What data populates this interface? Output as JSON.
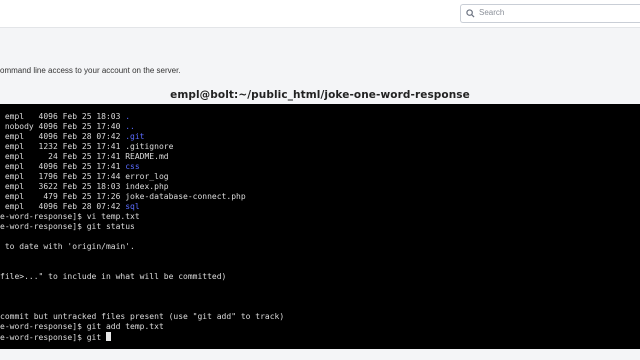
{
  "search": {
    "placeholder": "Search"
  },
  "description": "ommand line access to your account on the server.",
  "session_title": "empl@bolt:~/public_html/joke-one-word-response",
  "terminal": {
    "lines": [
      {
        "pre": " empl   4096 Feb 25 18:03 ",
        "hl": ".",
        "post": ""
      },
      {
        "pre": " nobody 4096 Feb 25 17:40 ",
        "hl": "..",
        "post": ""
      },
      {
        "pre": " empl   4096 Feb 28 07:42 ",
        "hl": ".git",
        "post": ""
      },
      {
        "pre": " empl   1232 Feb 25 17:41 .gitignore",
        "hl": "",
        "post": ""
      },
      {
        "pre": " empl     24 Feb 25 17:41 README.md",
        "hl": "",
        "post": ""
      },
      {
        "pre": " empl   4096 Feb 25 17:41 ",
        "hl": "css",
        "post": ""
      },
      {
        "pre": " empl   1796 Feb 25 17:44 error_log",
        "hl": "",
        "post": ""
      },
      {
        "pre": " empl   3622 Feb 25 18:03 index.php",
        "hl": "",
        "post": ""
      },
      {
        "pre": " empl    479 Feb 25 17:26 joke-database-connect.php",
        "hl": "",
        "post": ""
      },
      {
        "pre": " empl   4096 Feb 28 07:42 ",
        "hl": "sql",
        "post": ""
      },
      {
        "pre": "e-word-response]$ vi temp.txt",
        "hl": "",
        "post": ""
      },
      {
        "pre": "e-word-response]$ git status",
        "hl": "",
        "post": ""
      },
      {
        "pre": "",
        "hl": "",
        "post": ""
      },
      {
        "pre": " to date with 'origin/main'.",
        "hl": "",
        "post": ""
      },
      {
        "pre": "",
        "hl": "",
        "post": ""
      },
      {
        "pre": "",
        "hl": "",
        "post": ""
      },
      {
        "pre": "file>...\" to include in what will be committed)",
        "hl": "",
        "post": ""
      },
      {
        "pre": "",
        "hl": "",
        "post": ""
      },
      {
        "pre": "",
        "hl": "",
        "post": ""
      },
      {
        "pre": "",
        "hl": "",
        "post": ""
      },
      {
        "pre": "commit but untracked files present (use \"git add\" to track)",
        "hl": "",
        "post": ""
      },
      {
        "pre": "e-word-response]$ git add temp.txt",
        "hl": "",
        "post": ""
      },
      {
        "pre": "e-word-response]$ git ",
        "hl": "",
        "post": "",
        "cursor": true
      }
    ]
  },
  "colors": {
    "terminal_bg": "#000000",
    "dir_color": "#5b6cff",
    "text": "#dcdcdc"
  }
}
